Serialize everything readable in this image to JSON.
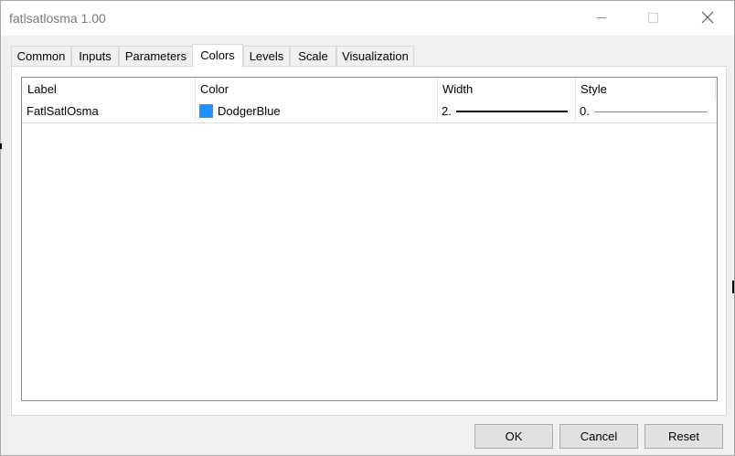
{
  "window": {
    "title": "fatlsatlosma 1.00"
  },
  "tabs": [
    {
      "label": "Common",
      "active": false
    },
    {
      "label": "Inputs",
      "active": false
    },
    {
      "label": "Parameters",
      "active": false
    },
    {
      "label": "Colors",
      "active": true
    },
    {
      "label": "Levels",
      "active": false
    },
    {
      "label": "Scale",
      "active": false
    },
    {
      "label": "Visualization",
      "active": false
    }
  ],
  "table": {
    "columns": [
      "Label",
      "Color",
      "Width",
      "Style"
    ],
    "rows": [
      {
        "label": "FatlSatlOsma",
        "color_name": "DodgerBlue",
        "color_hex": "#1e90ff",
        "width": "2.",
        "style": "0."
      }
    ]
  },
  "buttons": {
    "ok": "OK",
    "cancel": "Cancel",
    "reset": "Reset"
  }
}
